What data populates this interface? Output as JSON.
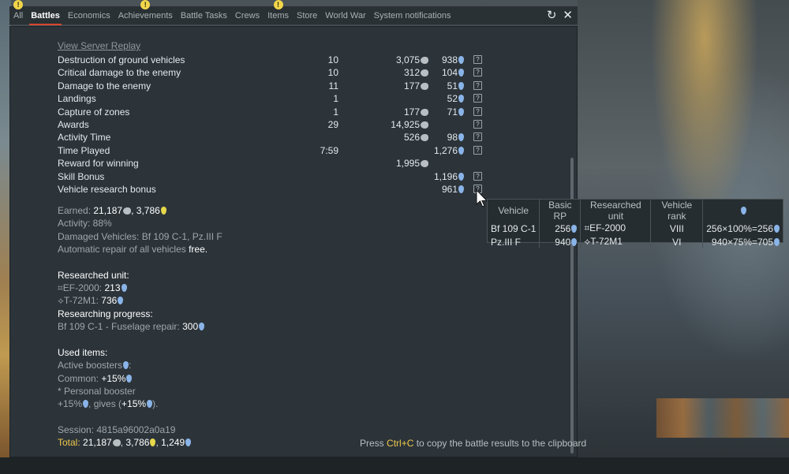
{
  "tabs": [
    {
      "label": "All",
      "alert": true
    },
    {
      "label": "Battles",
      "active": true,
      "alert": false
    },
    {
      "label": "Economics",
      "alert": false
    },
    {
      "label": "Achievements",
      "alert": true
    },
    {
      "label": "Battle Tasks",
      "alert": false
    },
    {
      "label": "Crews",
      "alert": false
    },
    {
      "label": "Items",
      "alert": true
    },
    {
      "label": "Store",
      "alert": false
    },
    {
      "label": "World War",
      "alert": false
    },
    {
      "label": "System notifications",
      "alert": false
    }
  ],
  "window": {
    "refresh_icon": "refresh-icon",
    "close_icon": "close-icon"
  },
  "replay_link": "View Server Replay",
  "stats": [
    {
      "label": "Destruction of ground vehicles",
      "count": "10",
      "sl": "3,075",
      "rp": "938",
      "help": true
    },
    {
      "label": "Critical damage to the enemy",
      "count": "10",
      "sl": "312",
      "rp": "104",
      "help": true
    },
    {
      "label": "Damage to the enemy",
      "count": "11",
      "sl": "177",
      "rp": "51",
      "help": true
    },
    {
      "label": "Landings",
      "count": "1",
      "sl": "",
      "rp": "52",
      "help": true
    },
    {
      "label": "Capture of zones",
      "count": "1",
      "sl": "177",
      "rp": "71",
      "help": true
    },
    {
      "label": "Awards",
      "count": "29",
      "sl": "14,925",
      "rp": "",
      "help": true
    },
    {
      "label": "Activity Time",
      "count": "",
      "sl": "526",
      "rp": "98",
      "help": true
    },
    {
      "label": "Time Played",
      "count": "7:59",
      "sl": "",
      "rp": "1,276",
      "help": true
    },
    {
      "label": "Reward for winning",
      "count": "",
      "sl": "1,995",
      "rp": "",
      "help": false
    },
    {
      "label": "Skill Bonus",
      "count": "",
      "sl": "",
      "rp": "1,196",
      "help": true
    },
    {
      "label": "Vehicle research bonus",
      "count": "",
      "sl": "",
      "rp": "961",
      "help": true
    }
  ],
  "summary": {
    "earned_label": "Earned:",
    "earned_sl": "21,187",
    "earned_gold": "3,786",
    "activity": "Activity: 88%",
    "damaged": "Damaged Vehicles: Bf 109 C-1, Pz.III F",
    "repair_prefix": "Automatic repair of all vehicles",
    "repair_value": "free."
  },
  "research": {
    "title": "Researched unit:",
    "units": [
      {
        "name": "⌗EF-2000:",
        "rp": "213"
      },
      {
        "name": "⟡T-72M1:",
        "rp": "736"
      }
    ],
    "progress_title": "Researching progress:",
    "progress_label": "Bf 109 C-1 - Fuselage repair:",
    "progress_value": "300"
  },
  "items": {
    "title": "Used items:",
    "active_boosters": "Active boosters",
    "common_label": "Common:",
    "common_value": "+15%",
    "personal": "* Personal booster",
    "personal_value": "+15%",
    "gives_label": ", gives (",
    "gives_value": "+15%",
    "gives_end": ")."
  },
  "session": "Session: 4815a96002a0a19",
  "total": {
    "label": "Total:",
    "sl": "21,187",
    "gold": "3,786",
    "rp": "1,249"
  },
  "clipboard_hint": {
    "prefix": "Press",
    "key": "Ctrl+C",
    "suffix": "to copy the battle results to the clipboard"
  },
  "tooltip": {
    "headers": [
      "Vehicle",
      "Basic RP",
      "Researched unit",
      "Vehicle rank"
    ],
    "rows": [
      {
        "vehicle": "Bf 109 C-1",
        "basic_rp": "256",
        "unit": "⌗EF-2000",
        "rank": "VIII",
        "formula": "256×100%=256"
      },
      {
        "vehicle": "Pz.III F",
        "basic_rp": "940",
        "unit": "⟡T-72M1",
        "rank": "VI",
        "formula": "940×75%=705"
      }
    ]
  },
  "colors": {
    "accent": "#d8452a",
    "research": "#8ab4e8",
    "gold": "#e6d84a",
    "key": "#f0c84a"
  }
}
